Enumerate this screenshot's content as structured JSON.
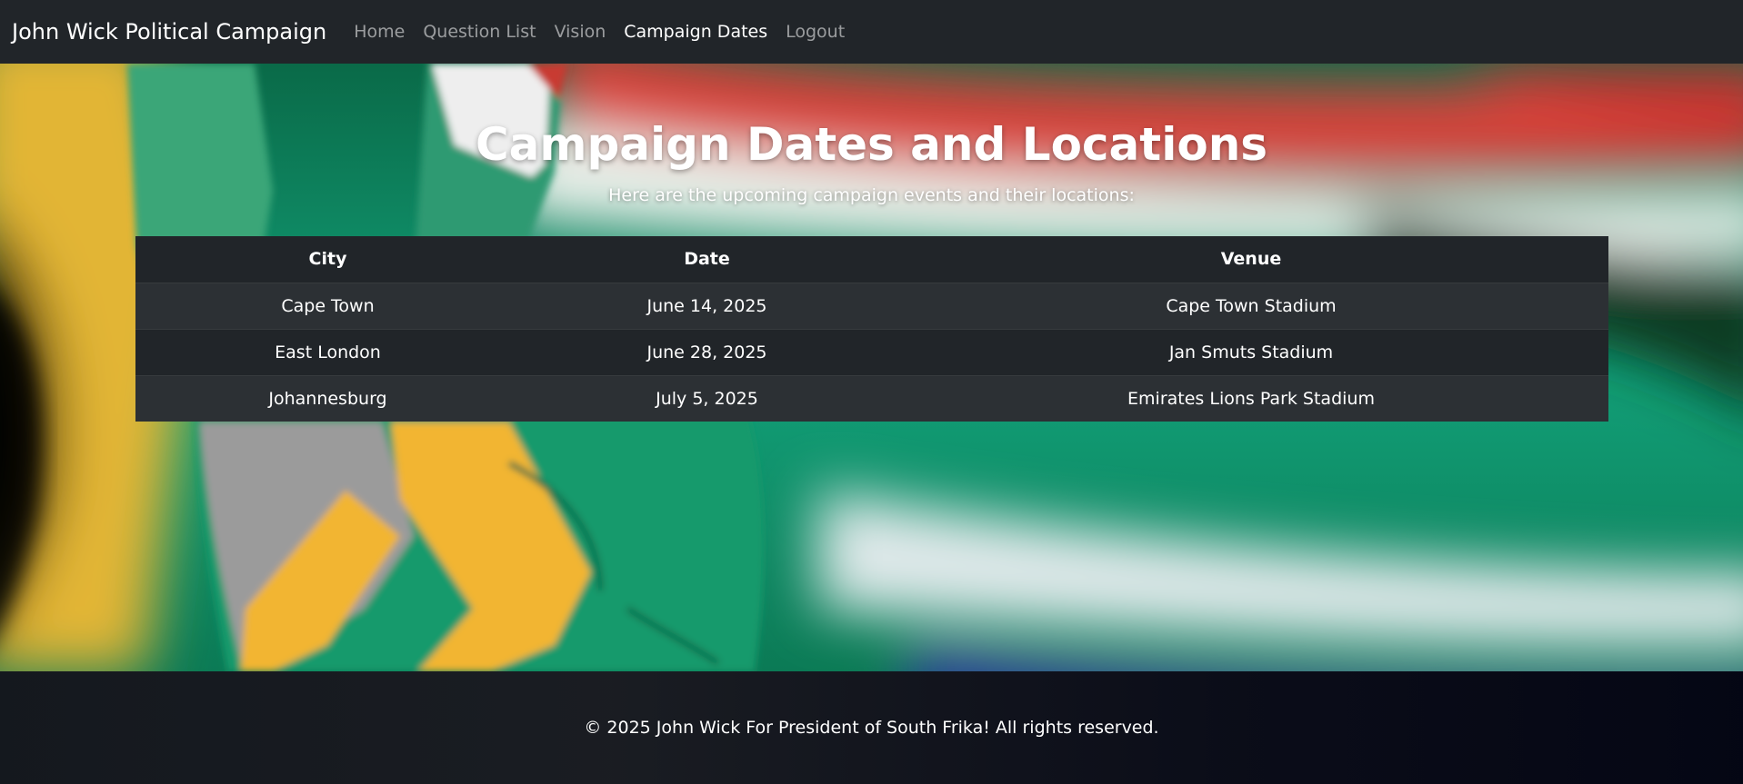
{
  "navbar": {
    "brand": "John Wick Political Campaign",
    "links": [
      {
        "label": "Home",
        "active": false
      },
      {
        "label": "Question List",
        "active": false
      },
      {
        "label": "Vision",
        "active": false
      },
      {
        "label": "Campaign Dates",
        "active": true
      },
      {
        "label": "Logout",
        "active": false
      }
    ]
  },
  "main": {
    "title": "Campaign Dates and Locations",
    "subtitle": "Here are the upcoming campaign events and their locations:"
  },
  "table": {
    "headers": [
      "City",
      "Date",
      "Venue"
    ],
    "rows": [
      [
        "Cape Town",
        "June 14, 2025",
        "Cape Town Stadium"
      ],
      [
        "East London",
        "June 28, 2025",
        "Jan Smuts Stadium"
      ],
      [
        "Johannesburg",
        "July 5, 2025",
        "Emirates Lions Park Stadium"
      ]
    ]
  },
  "footer": {
    "text": "© 2025 John Wick For President of South Frika! All rights reserved."
  },
  "colors": {
    "navbar_bg": "#212529",
    "table_dark": "#212529",
    "table_stripe": "#2c3034",
    "flag_green": "#0c8f63",
    "flag_yellow": "#f2b531",
    "flag_red": "#d23a32",
    "flag_blue": "#2d3f9e"
  },
  "background_image": "hand-peace-sign-painted-south-african-flag"
}
